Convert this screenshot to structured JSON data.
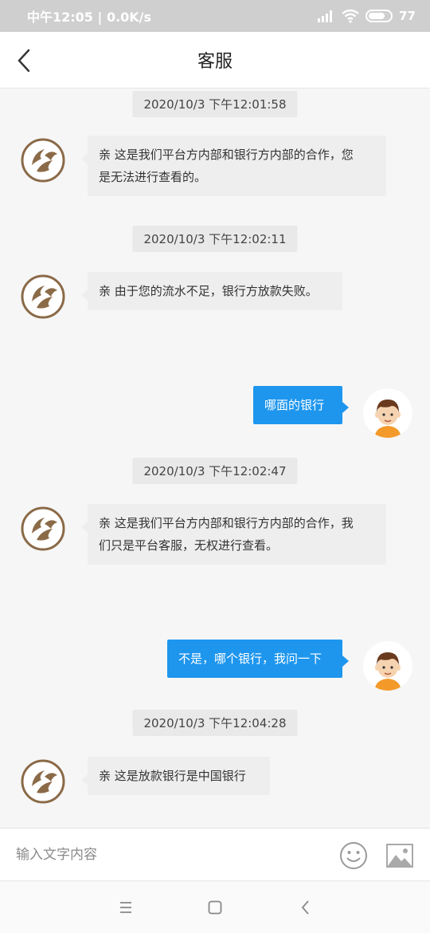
{
  "status_bar": {
    "time": "中午12:05",
    "speed": "0.0K/s",
    "battery": "77"
  },
  "header": {
    "title": "客服"
  },
  "messages": [
    {
      "time": "2020/10/3 下午12:01:58"
    },
    {
      "side": "agent",
      "line1": "亲 这是我们平台方内部和银行方内部的合作，您",
      "line2": "是无法进行查看的。"
    },
    {
      "time": "2020/10/3 下午12:02:11"
    },
    {
      "side": "agent",
      "text": "亲 由于您的流水不足，银行方放款失败。"
    },
    {
      "side": "user",
      "text": "哪面的银行"
    },
    {
      "time": "2020/10/3 下午12:02:47"
    },
    {
      "side": "agent",
      "line1": "亲 这是我们平台方内部和银行方内部的合作，我",
      "line2": "们只是平台客服，无权进行查看。"
    },
    {
      "side": "user",
      "text": "不是，哪个银行，我问一下"
    },
    {
      "time": "2020/10/3 下午12:04:28"
    },
    {
      "side": "agent",
      "text": "亲 这是放款银行是中国银行"
    }
  ],
  "input": {
    "placeholder": "输入文字内容"
  },
  "colors": {
    "user_bubble": "#1e96ee",
    "agent_bubble": "#eeeeee",
    "logo_brown": "#8b6a48"
  }
}
